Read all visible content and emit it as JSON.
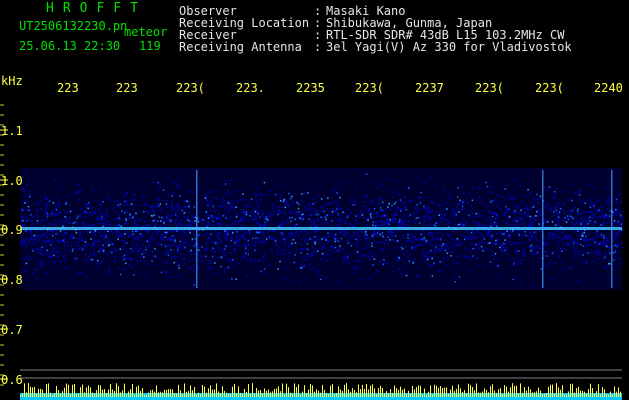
{
  "header": {
    "logo": "HROFFT",
    "filename": "UT2506132230.pn",
    "mode": "meteor",
    "datetime": "25.06.13 22:30",
    "count": "119",
    "labels": {
      "observer": "Observer",
      "location": "Receiving Location",
      "receiver": "Receiver",
      "antenna": "Receiving Antenna"
    },
    "colons": {
      "c1": ":",
      "c2": ":",
      "c3": ":",
      "c4": ":"
    },
    "values": {
      "observer": "Masaki Kano",
      "location": "Shibukawa, Gunma, Japan",
      "receiver": "RTL-SDR SDR# 43dB L15 103.2MHz CW",
      "antenna": "3el Yagi(V) Az 330 for Vladivostok"
    }
  },
  "axes": {
    "unit": "kHz",
    "y_ticks": [
      "1.1",
      "1.0",
      "0.9",
      "0.8",
      "0.7",
      "0.6"
    ],
    "x_ticks": [
      "223",
      "223",
      "223(",
      "223.",
      "2235",
      "223(",
      "2237",
      "223(",
      "223(",
      "2240"
    ]
  },
  "colors": {
    "background": "#000000",
    "header_text": "#e6e6e6",
    "logo": "#00e000",
    "axis_labels": "#ffff40",
    "signal_band": "#0000c8",
    "signal_line": "#40c8ff",
    "bottom_bar": "#00c8ff"
  }
}
